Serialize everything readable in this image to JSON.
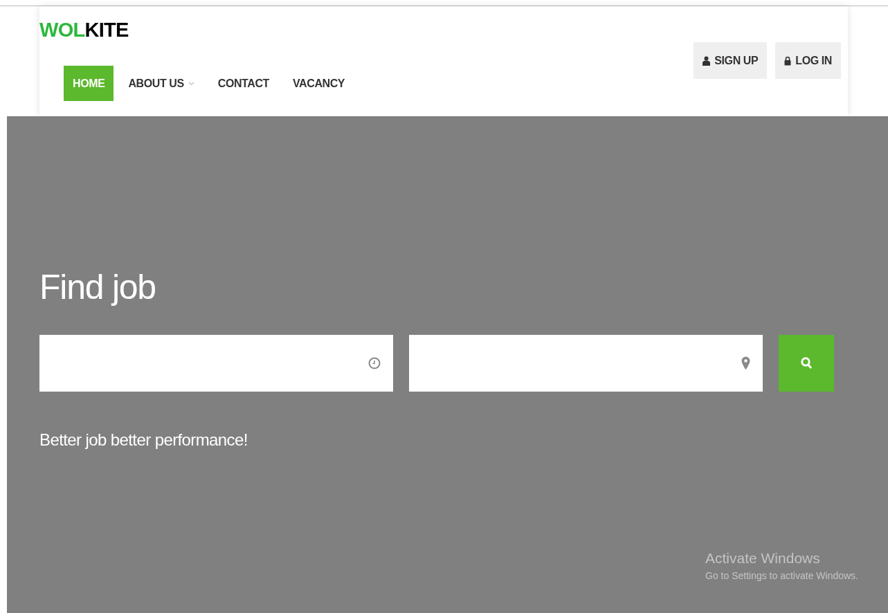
{
  "logo": {
    "accent": "WOL",
    "rest": "KITE"
  },
  "nav": [
    {
      "label": "HOME",
      "selected": true,
      "dropdown": false
    },
    {
      "label": "ABOUT US",
      "selected": false,
      "dropdown": true
    },
    {
      "label": "CONTACT",
      "selected": false,
      "dropdown": false
    },
    {
      "label": "VACANCY",
      "selected": false,
      "dropdown": false
    }
  ],
  "auth_buttons": [
    {
      "label": "SIGN UP",
      "kind": "user"
    },
    {
      "label": "LOG IN",
      "kind": "lock"
    }
  ],
  "hero": {
    "title": "Find job",
    "fields": [
      {
        "kind": "clock"
      },
      {
        "kind": "pin"
      }
    ],
    "tagline": "Better job better performance!"
  },
  "os_notice": {
    "title": "Activate Windows",
    "text": "Go to Settings to activate Windows."
  }
}
